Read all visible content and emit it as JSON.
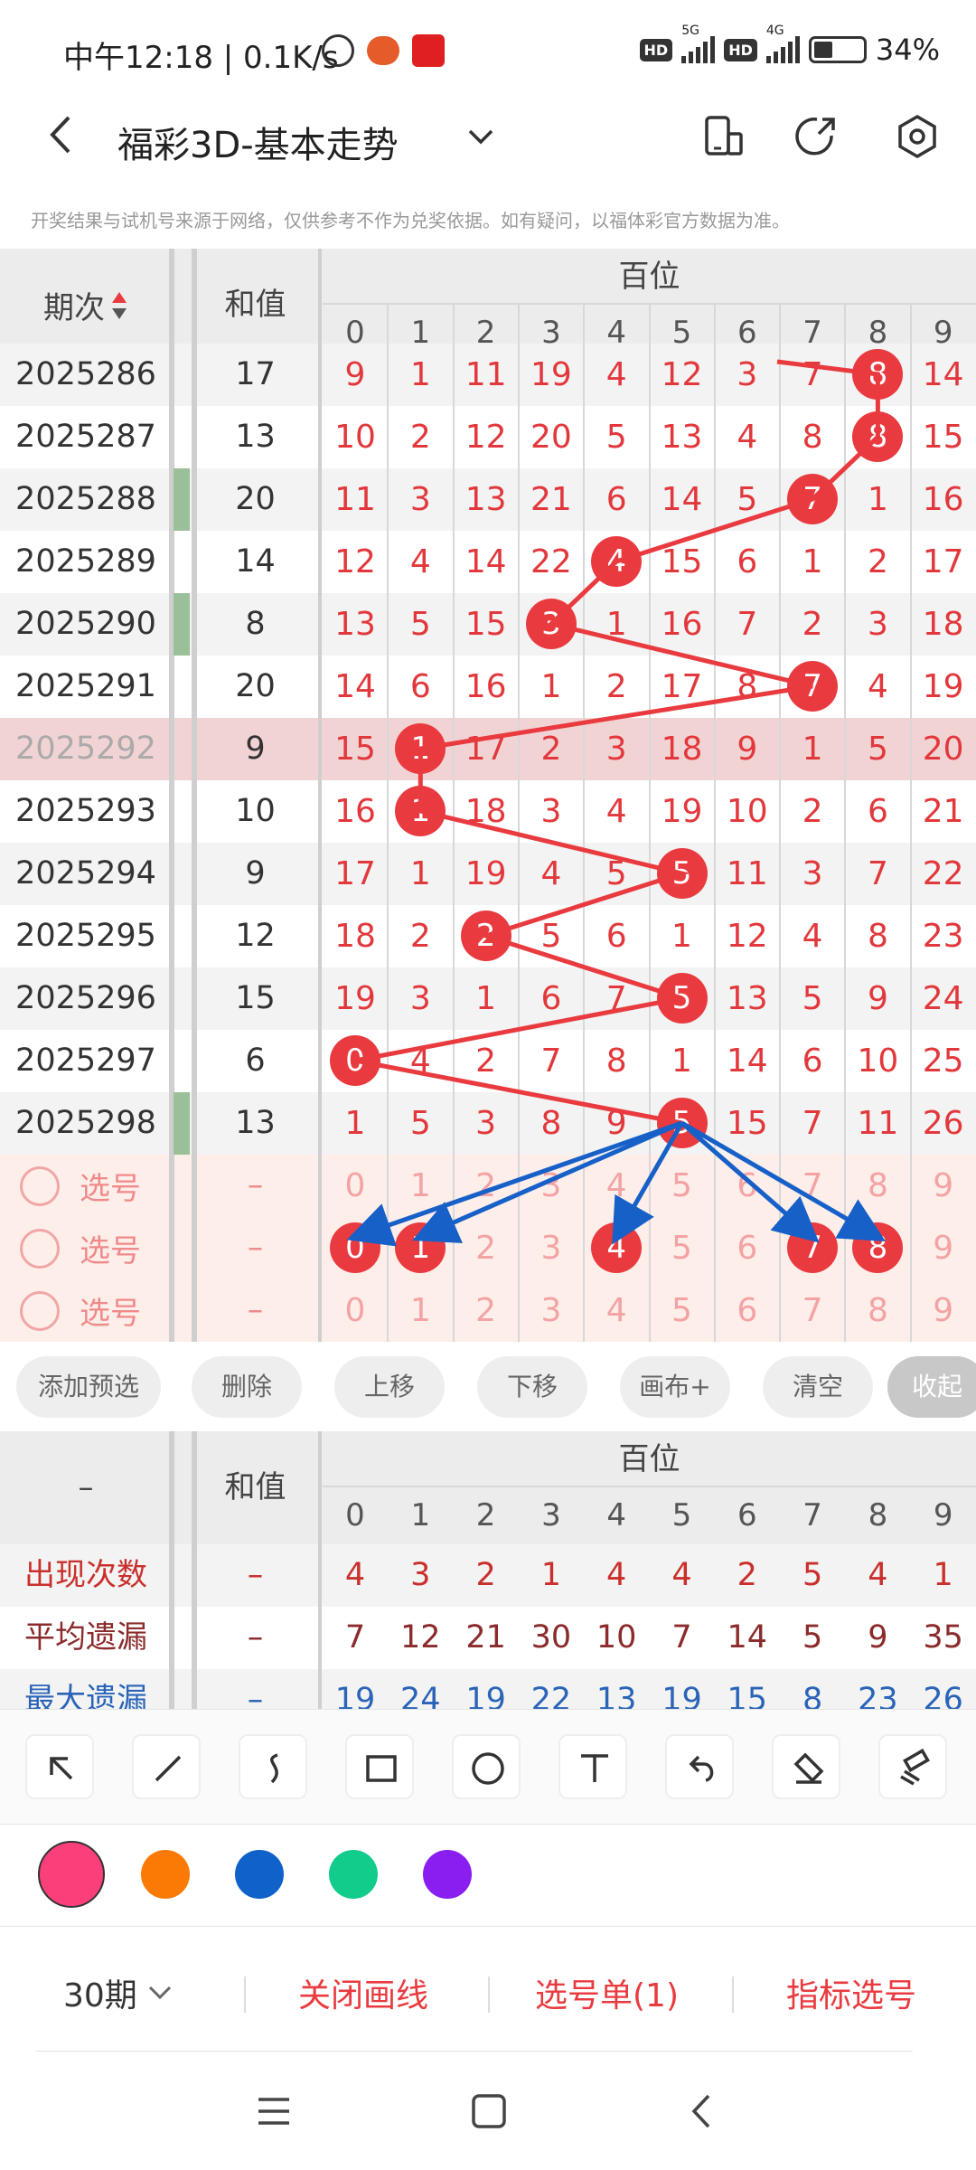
{
  "status_bar": {
    "time": "中午12:18 | 0.1K/s",
    "hd1": "HD",
    "net1": "5G",
    "hd2": "HD",
    "net2": "4G",
    "battery": "34%"
  },
  "nav": {
    "title": "福彩3D-基本走势",
    "back_icon": "back-arrow-icon",
    "dropdown_icon": "chevron-down-icon"
  },
  "disclaimer": "开奖结果与试机号来源于网络，仅供参考不作为兑奖依据。如有疑问，以福体彩官方数据为准。",
  "table": {
    "col_period": "期次",
    "col_sum": "和值",
    "col_group": "百位",
    "digits": [
      "0",
      "1",
      "2",
      "3",
      "4",
      "5",
      "6",
      "7",
      "8",
      "9"
    ],
    "rows": [
      {
        "period": "2025286",
        "sum": "17",
        "vals": [
          "9",
          "1",
          "11",
          "19",
          "4",
          "12",
          "3",
          "7",
          "8",
          "14"
        ],
        "hit": 8,
        "band": "#f3f3f3"
      },
      {
        "period": "2025287",
        "sum": "13",
        "vals": [
          "10",
          "2",
          "12",
          "20",
          "5",
          "13",
          "4",
          "8",
          "8",
          "15"
        ],
        "hit": 8,
        "band": "#ffffff"
      },
      {
        "period": "2025288",
        "sum": "20",
        "vals": [
          "11",
          "3",
          "13",
          "21",
          "6",
          "14",
          "5",
          "7",
          "1",
          "16"
        ],
        "hit": 7,
        "band": "#f3f3f3"
      },
      {
        "period": "2025289",
        "sum": "14",
        "vals": [
          "12",
          "4",
          "14",
          "22",
          "4",
          "15",
          "6",
          "1",
          "2",
          "17"
        ],
        "hit": 4,
        "band": "#ffffff"
      },
      {
        "period": "2025290",
        "sum": "8",
        "vals": [
          "13",
          "5",
          "15",
          "3",
          "1",
          "16",
          "7",
          "2",
          "3",
          "18"
        ],
        "hit": 3,
        "band": "#f3f3f3"
      },
      {
        "period": "2025291",
        "sum": "20",
        "vals": [
          "14",
          "6",
          "16",
          "1",
          "2",
          "17",
          "8",
          "7",
          "4",
          "19"
        ],
        "hit": 7,
        "band": "#ffffff"
      },
      {
        "period": "2025292",
        "sum": "9",
        "vals": [
          "15",
          "1",
          "17",
          "2",
          "3",
          "18",
          "9",
          "1",
          "5",
          "20"
        ],
        "hit": 1,
        "band": "#f2d3d4"
      },
      {
        "period": "2025293",
        "sum": "10",
        "vals": [
          "16",
          "1",
          "18",
          "3",
          "4",
          "19",
          "10",
          "2",
          "6",
          "21"
        ],
        "hit": 1,
        "band": "#ffffff"
      },
      {
        "period": "2025294",
        "sum": "9",
        "vals": [
          "17",
          "1",
          "19",
          "4",
          "5",
          "5",
          "11",
          "3",
          "7",
          "22"
        ],
        "hit": 5,
        "band": "#f3f3f3"
      },
      {
        "period": "2025295",
        "sum": "12",
        "vals": [
          "18",
          "2",
          "2",
          "5",
          "6",
          "1",
          "12",
          "4",
          "8",
          "23"
        ],
        "hit": 2,
        "band": "#ffffff"
      },
      {
        "period": "2025296",
        "sum": "15",
        "vals": [
          "19",
          "3",
          "1",
          "6",
          "7",
          "5",
          "13",
          "5",
          "9",
          "24"
        ],
        "hit": 5,
        "band": "#f3f3f3"
      },
      {
        "period": "2025297",
        "sum": "6",
        "vals": [
          "0",
          "4",
          "2",
          "7",
          "8",
          "1",
          "14",
          "6",
          "10",
          "25"
        ],
        "hit": 0,
        "band": "#ffffff"
      },
      {
        "period": "2025298",
        "sum": "13",
        "vals": [
          "1",
          "5",
          "3",
          "8",
          "9",
          "5",
          "15",
          "7",
          "11",
          "26"
        ],
        "hit": 5,
        "band": "#f3f3f3"
      }
    ],
    "select_rows": [
      {
        "label": "选号",
        "sum": "–",
        "picked": []
      },
      {
        "label": "选号",
        "sum": "–",
        "picked": [
          0,
          1,
          4,
          7,
          8
        ]
      },
      {
        "label": "选号",
        "sum": "–",
        "picked": []
      }
    ]
  },
  "actions": {
    "add": "添加预选",
    "delete": "删除",
    "up": "上移",
    "down": "下移",
    "canvas": "画布+",
    "clear": "清空",
    "collapse": "收起"
  },
  "stats": {
    "corner": "–",
    "col_sum": "和值",
    "col_group": "百位",
    "rows": [
      {
        "label": "出现次数",
        "sum": "–",
        "vals": [
          "4",
          "3",
          "2",
          "1",
          "4",
          "4",
          "2",
          "5",
          "4",
          "1"
        ],
        "color": "#c9302c"
      },
      {
        "label": "平均遗漏",
        "sum": "–",
        "vals": [
          "7",
          "12",
          "21",
          "30",
          "10",
          "7",
          "14",
          "5",
          "9",
          "35"
        ],
        "color": "#8b2b2b"
      },
      {
        "label": "最大遗漏",
        "sum": "–",
        "vals": [
          "19",
          "24",
          "19",
          "22",
          "13",
          "19",
          "15",
          "8",
          "23",
          "26"
        ],
        "color": "#2a64b8"
      }
    ]
  },
  "tools": [
    "arrow-tool-icon",
    "line-tool-icon",
    "freehand-tool-icon",
    "rectangle-tool-icon",
    "circle-tool-icon",
    "text-tool-icon",
    "undo-icon",
    "eraser-icon",
    "clear-canvas-icon"
  ],
  "colors": [
    "#fb3f7a",
    "#fb7a06",
    "#0f62c9",
    "#12cc8c",
    "#8a1ef0"
  ],
  "bottom": {
    "periods": "30期",
    "close_lines": "关闭画线",
    "selection_list": "选号单(1)",
    "indicator_select": "指标选号"
  },
  "accent": "#e93b3f"
}
